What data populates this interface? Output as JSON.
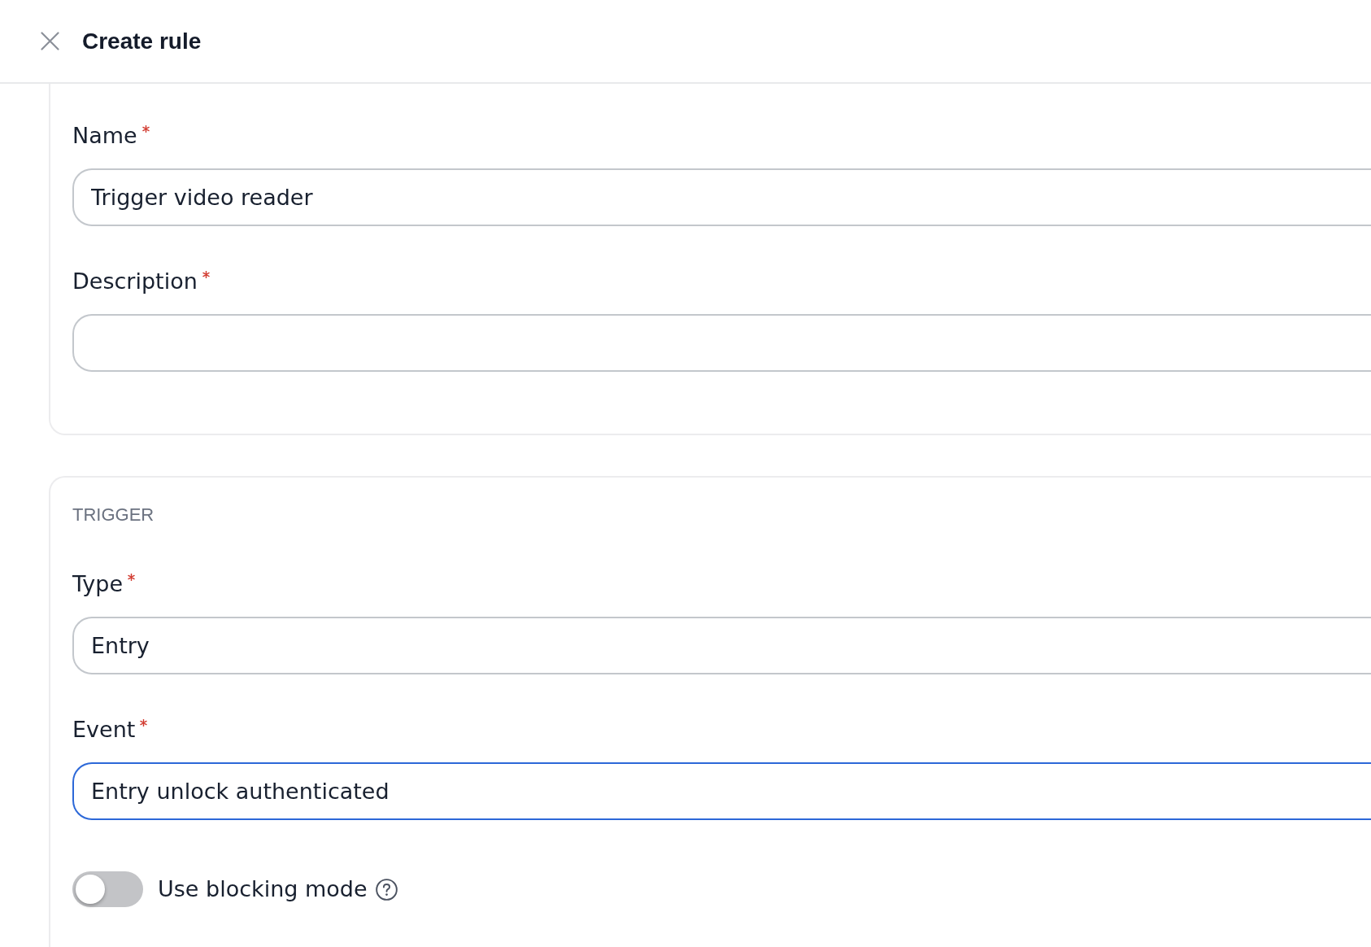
{
  "header": {
    "title": "Create rule"
  },
  "sections": [
    {
      "fields": [
        {
          "label": "Name",
          "required": true,
          "value": "Trigger video reader",
          "focused": false
        },
        {
          "label": "Description",
          "required": true,
          "focused": false
        }
      ]
    },
    {
      "heading": "TRIGGER",
      "fields": [
        {
          "label": "Type",
          "required": true,
          "value": "Entry",
          "focused": false
        },
        {
          "label": "Event",
          "required": true,
          "value": "Entry unlock authenticated",
          "focused": true
        }
      ],
      "toggles": [
        {
          "label": "Use blocking mode",
          "on": false,
          "help": true
        }
      ]
    }
  ]
}
